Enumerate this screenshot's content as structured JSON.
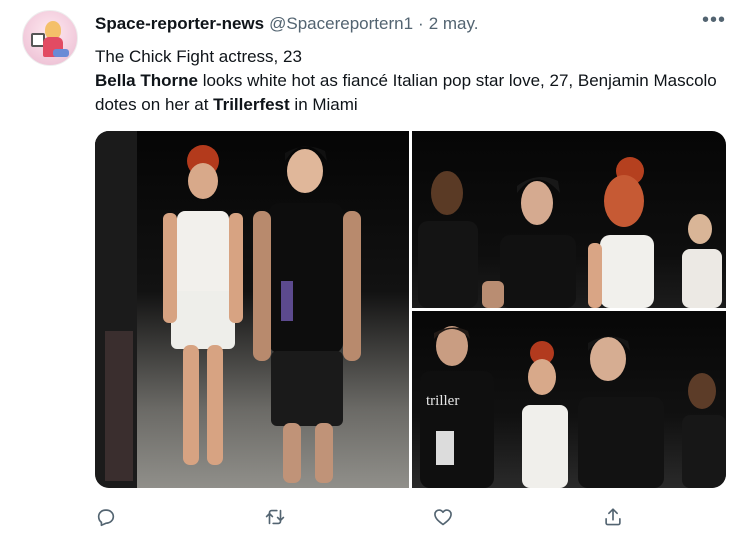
{
  "tweet": {
    "author_name": "Space-reporter-news",
    "handle": "@Spacereportern1",
    "separator": "·",
    "date": "2 may.",
    "more_icon": "more-horizontal-icon",
    "line1": "The Chick Fight actress, 23",
    "bold_name": "Bella Thorne",
    "line2_mid": " looks white hot as fiancé Italian pop star love, 27, Benjamin Mascolo dotes on her at ",
    "bold_event": "Trillerfest",
    "line2_end": " in Miami"
  },
  "media": {
    "shirt_text": "triller"
  },
  "actions": {
    "reply_icon": "reply-icon",
    "retweet_icon": "retweet-icon",
    "like_icon": "heart-icon",
    "share_icon": "share-icon"
  },
  "colors": {
    "text_primary": "#0f1419",
    "text_secondary": "#536471",
    "background": "#ffffff"
  }
}
